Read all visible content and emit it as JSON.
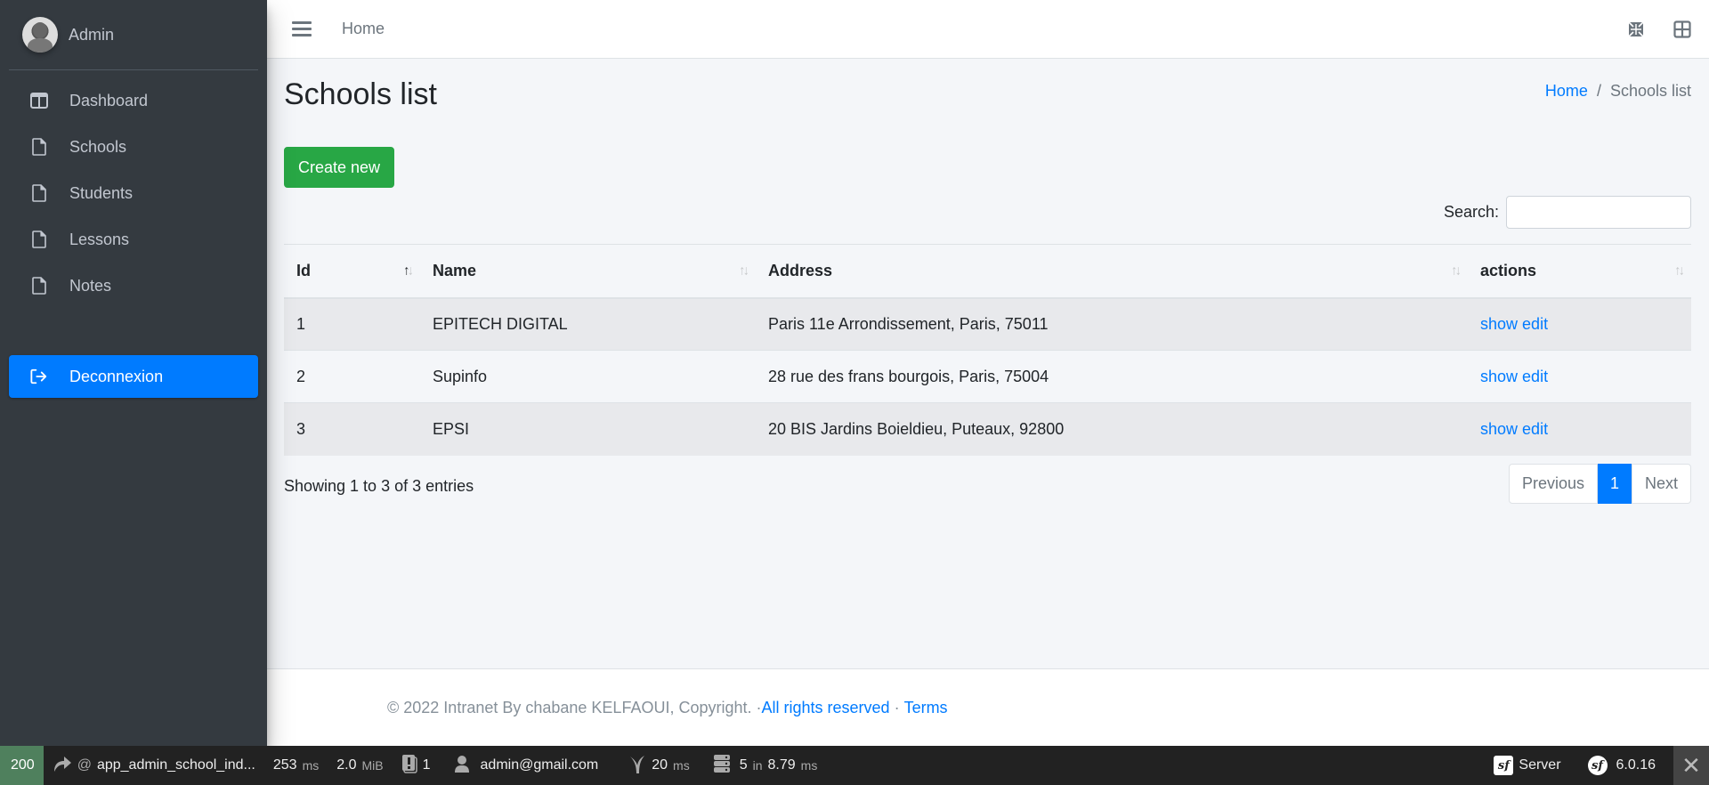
{
  "sidebar": {
    "user_name": "Admin",
    "items": [
      {
        "label": "Dashboard",
        "icon": "columns-icon"
      },
      {
        "label": "Schools",
        "icon": "file-icon"
      },
      {
        "label": "Students",
        "icon": "file-icon"
      },
      {
        "label": "Lessons",
        "icon": "file-icon"
      },
      {
        "label": "Notes",
        "icon": "file-icon"
      }
    ],
    "logout_label": "Deconnexion",
    "active_color": "#007bff"
  },
  "topbar": {
    "home_link": "Home",
    "icons": [
      "expand-arrows-icon",
      "th-large-icon"
    ]
  },
  "page": {
    "title": "Schools list",
    "breadcrumb": {
      "home": "Home",
      "separator": "/",
      "current": "Schools list"
    },
    "create_button": "Create new",
    "search_label": "Search:",
    "search_value": ""
  },
  "table": {
    "columns": [
      "Id",
      "Name",
      "Address",
      "actions"
    ],
    "sorted_column": "Id",
    "sort_direction": "asc",
    "rows": [
      {
        "id": "1",
        "name": "EPITECH DIGITAL",
        "address": "Paris 11e Arrondissement, Paris, 75011",
        "show": "show",
        "edit": "edit"
      },
      {
        "id": "2",
        "name": "Supinfo",
        "address": "28 rue des frans bourgois, Paris, 75004",
        "show": "show",
        "edit": "edit"
      },
      {
        "id": "3",
        "name": "EPSI",
        "address": "20 BIS Jardins Boieldieu, Puteaux, 92800",
        "show": "show",
        "edit": "edit"
      }
    ],
    "info": "Showing 1 to 3 of 3 entries",
    "pagination": {
      "previous": "Previous",
      "current": "1",
      "next": "Next"
    }
  },
  "footer": {
    "text": "© 2022 Intranet By chabane KELFAOUI, Copyright. · ",
    "rights_link": "All rights reserved",
    "separator": " · ",
    "terms_link": "Terms"
  },
  "debug_toolbar": {
    "status_code": "200",
    "route": "app_admin_school_ind...",
    "route_prefix": "@",
    "time_value": "253",
    "time_unit": "ms",
    "memory_value": "2.0",
    "memory_unit": "MiB",
    "logs_count": "1",
    "user": "admin@gmail.com",
    "twig_value": "20",
    "twig_unit": "ms",
    "db_queries": "5",
    "db_in": "in",
    "db_time": "8.79",
    "db_unit": "ms",
    "server_label": "Server",
    "version": "6.0.16",
    "status_color": "#4f805d"
  }
}
